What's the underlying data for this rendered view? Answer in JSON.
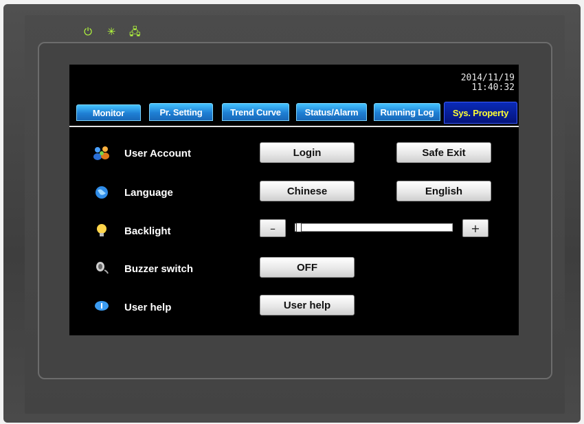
{
  "device": {
    "leds": [
      {
        "name": "power-led-icon",
        "glyph": "⏻"
      },
      {
        "name": "status-led-icon",
        "glyph": "✳"
      },
      {
        "name": "network-led-icon",
        "glyph": "🖧"
      }
    ],
    "led_color": "#b7ff3c"
  },
  "clock": {
    "date": "2014/11/19",
    "time": "11:40:32"
  },
  "tabs": [
    {
      "label": "Monitor",
      "active": false
    },
    {
      "label": "Pr. Setting",
      "active": false
    },
    {
      "label": "Trend Curve",
      "active": false
    },
    {
      "label": "Status/Alarm",
      "active": false
    },
    {
      "label": "Running Log",
      "active": false
    },
    {
      "label": "Sys. Property",
      "active": true
    }
  ],
  "rows": {
    "user_account": {
      "label": "User Account",
      "icon": "users-icon",
      "buttons": [
        "Login",
        "Safe Exit"
      ]
    },
    "language": {
      "label": "Language",
      "icon": "globe-icon",
      "buttons": [
        "Chinese",
        "English"
      ]
    },
    "backlight": {
      "label": "Backlight",
      "icon": "bulb-icon",
      "minus": "–",
      "plus": "+",
      "level": 0.0
    },
    "buzzer": {
      "label": "Buzzer switch",
      "icon": "speaker-icon",
      "button": "OFF"
    },
    "help": {
      "label": "User help",
      "icon": "info-icon",
      "button": "User help"
    }
  },
  "colors": {
    "tab_active_text": "#ffff33",
    "tab_bg": "#1f7fd4"
  }
}
